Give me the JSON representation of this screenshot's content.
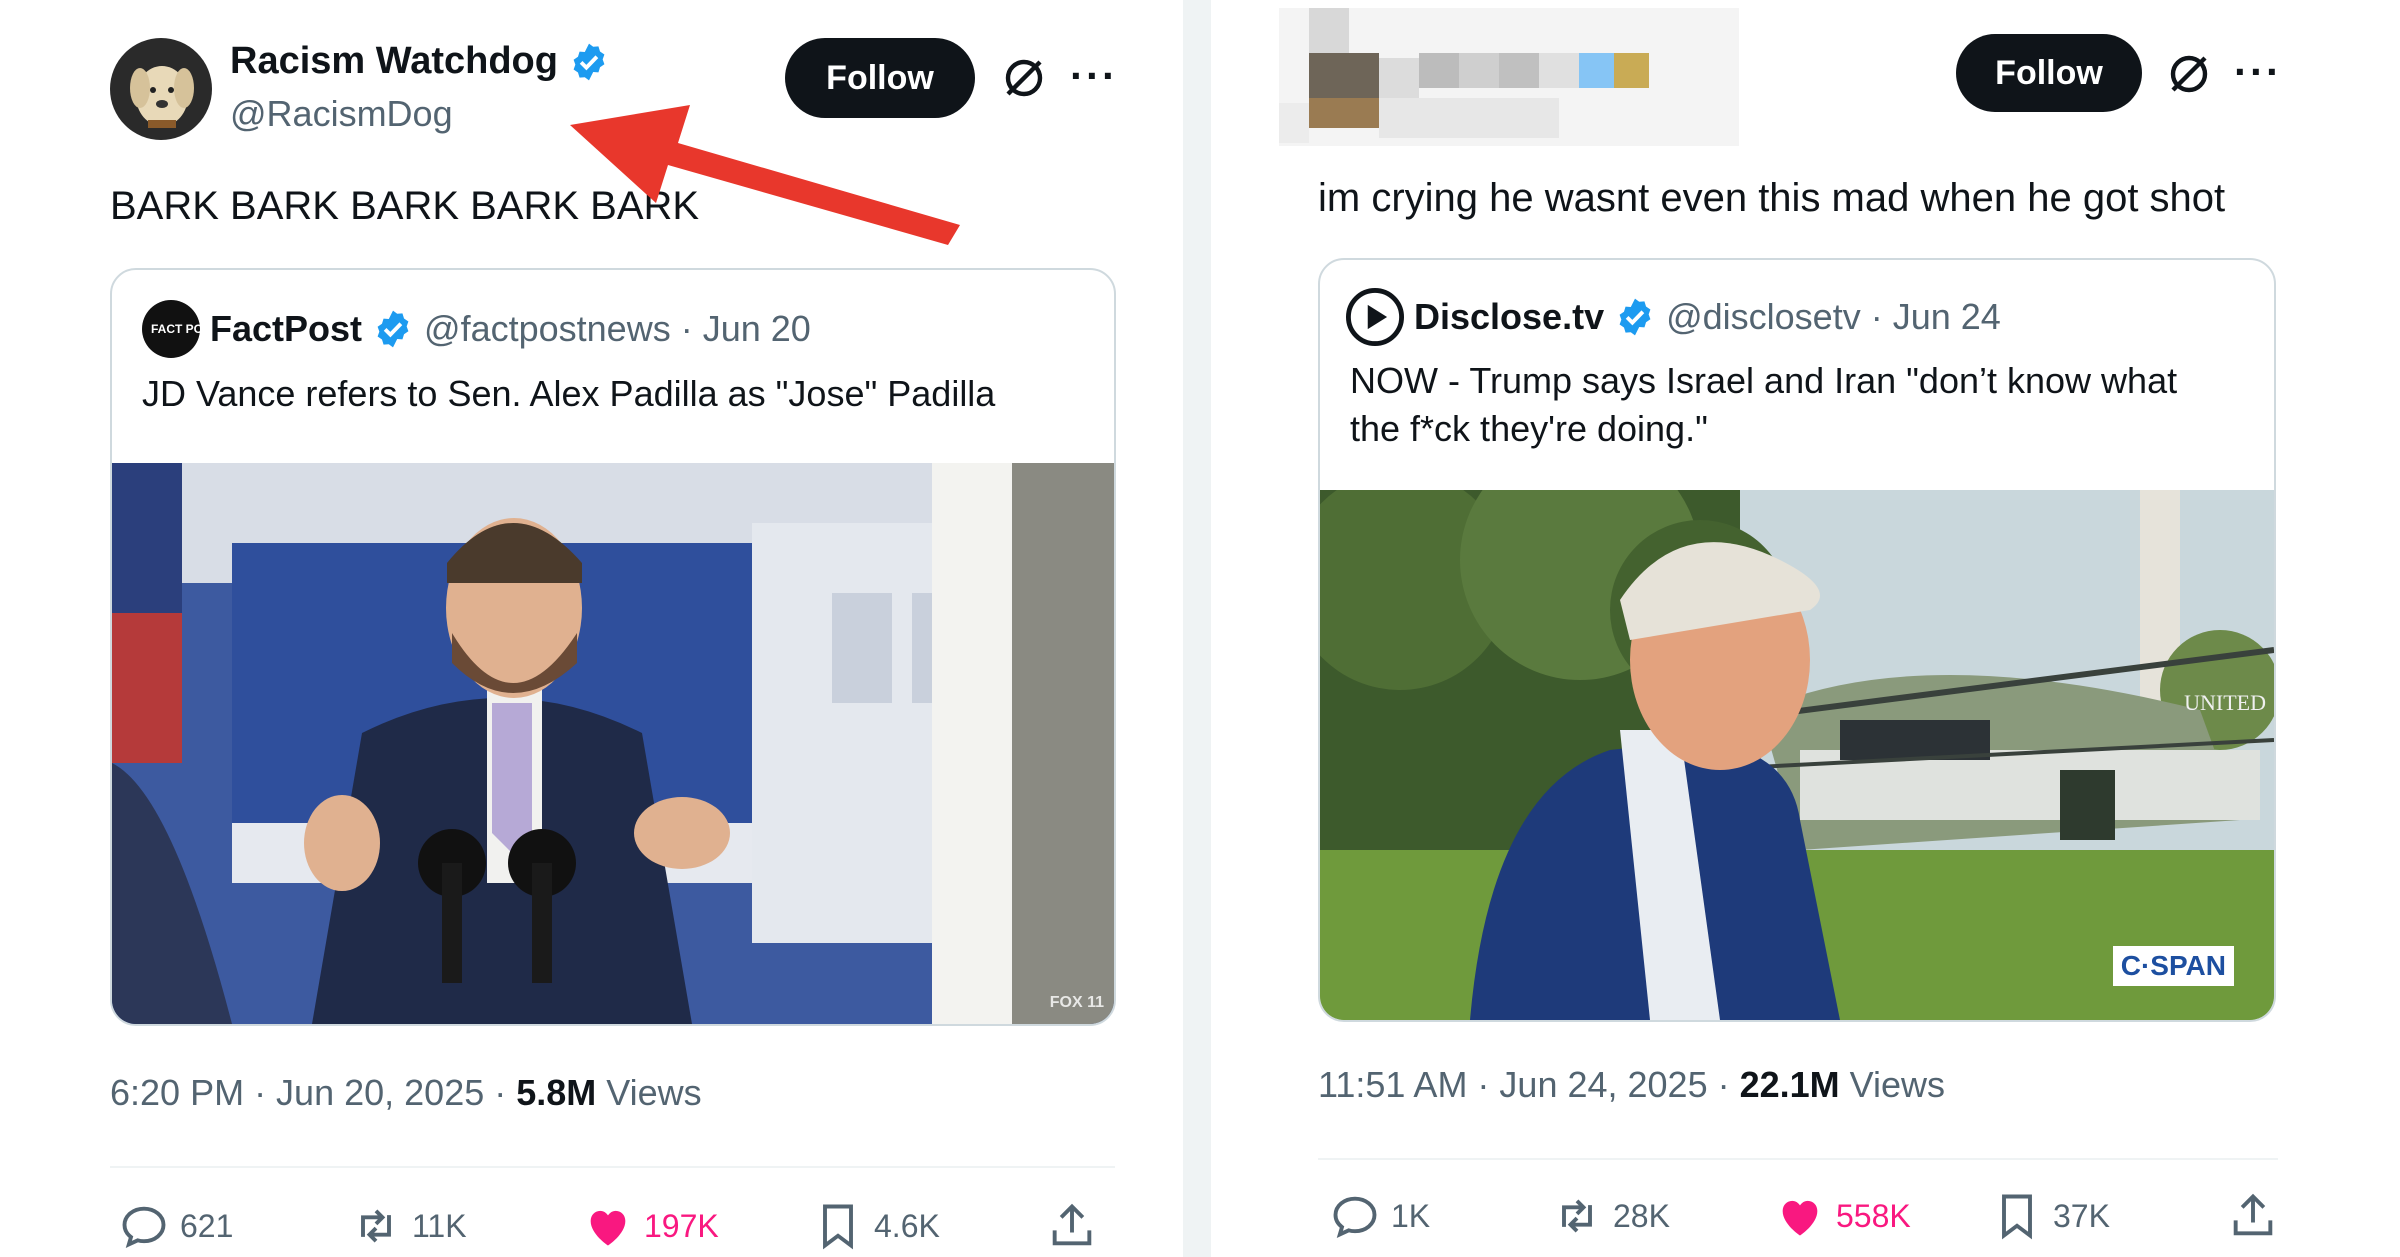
{
  "left_post": {
    "author_name": "Racism Watchdog",
    "author_handle": "@RacismDog",
    "follow_label": "Follow",
    "more_label": "···",
    "text": "BARK BARK BARK BARK BARK",
    "quote": {
      "author_name": "FactPost",
      "author_handle": "@factpostnews",
      "date": "· Jun 20",
      "text": "JD Vance refers to Sen. Alex Padilla as \"Jose\" Padilla",
      "logo_text": "FACT POST",
      "watermark": "FOX 11"
    },
    "time": "6:20 PM · Jun 20, 2025 · ",
    "views_count": "5.8M",
    "views_label": " Views",
    "actions": {
      "replies": "621",
      "reposts": "11K",
      "likes": "197K",
      "bookmarks": "4.6K"
    }
  },
  "right_post": {
    "follow_label": "Follow",
    "more_label": "···",
    "text": "im crying he wasnt even this mad when he got shot",
    "quote": {
      "author_name": "Disclose.tv",
      "author_handle": "@disclosetv",
      "date": "· Jun 24",
      "text_line1": "NOW - Trump says Israel and Iran \"don’t know what",
      "text_line2": "the f*ck they're doing.\"",
      "watermark": "C·SPAN",
      "helicopter_text": "UNITED"
    },
    "time": "11:51 AM · Jun 24, 2025 · ",
    "views_count": "22.1M",
    "views_label": " Views",
    "actions": {
      "replies": "1K",
      "reposts": "28K",
      "likes": "558K",
      "bookmarks": "37K"
    }
  },
  "colors": {
    "verified": "#1d9bf0",
    "like": "#f91880",
    "arrow": "#e8372c",
    "secondary": "#536471"
  }
}
